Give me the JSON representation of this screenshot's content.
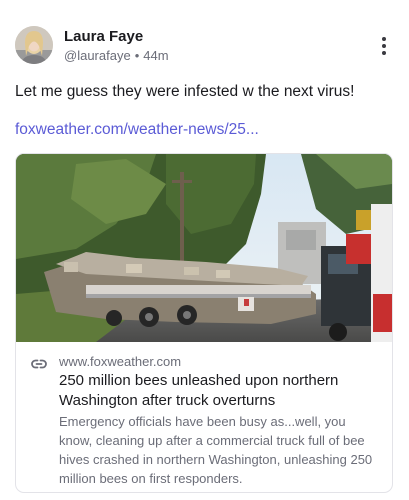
{
  "post": {
    "author_name": "Laura Faye",
    "handle": "@laurafaye",
    "separator": "•",
    "time_ago": "44m",
    "text": "Let me guess they were infested w the next virus!",
    "link_text": "foxweather.com/weather-news/25..."
  },
  "preview": {
    "domain": "www.foxweather.com",
    "title": "250 million bees unleashed upon northern Washington after truck overturns",
    "description": "Emergency officials have been busy as...well, you know, cleaning up after a commercial truck full of bee hives crashed in northern Washington, unleashing 250 million bees on first responders."
  },
  "colors": {
    "link": "#5b5bd6",
    "muted": "#6b6d78",
    "text": "#1b1b1f",
    "border": "#e3e3e8"
  },
  "icons": [
    "avatar",
    "more-options-icon",
    "link-icon"
  ]
}
